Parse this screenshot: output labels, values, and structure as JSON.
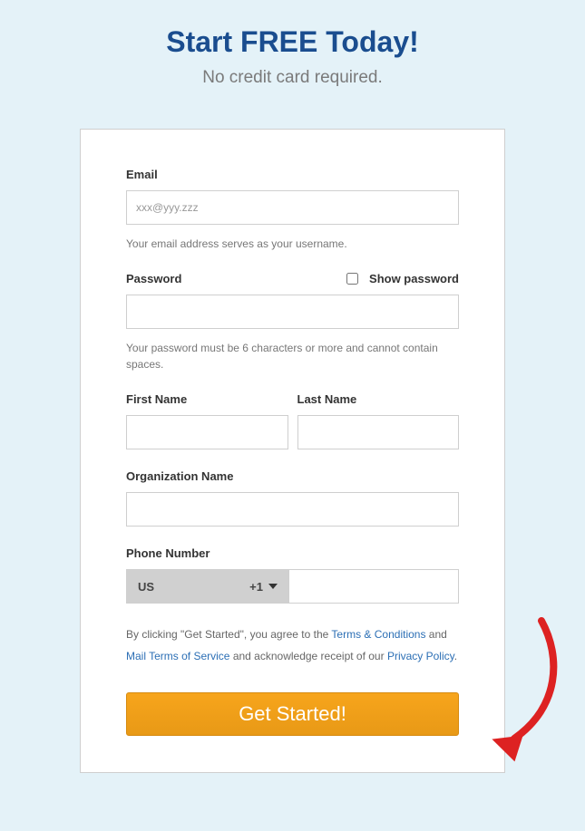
{
  "header": {
    "title": "Start FREE Today!",
    "subtitle": "No credit card required."
  },
  "form": {
    "email": {
      "label": "Email",
      "placeholder": "xxx@yyy.zzz",
      "helper": "Your email address serves as your username."
    },
    "password": {
      "label": "Password",
      "show_label": "Show password",
      "helper": "Your password must be 6 characters or more and cannot contain spaces."
    },
    "first_name": {
      "label": "First Name"
    },
    "last_name": {
      "label": "Last Name"
    },
    "organization": {
      "label": "Organization Name"
    },
    "phone": {
      "label": "Phone Number",
      "country": "US",
      "code": "+1"
    },
    "terms": {
      "prefix": "By clicking \"Get Started\", you agree to the ",
      "link1": "Terms & Conditions",
      "mid1": " and ",
      "link2": "Mail Terms of Service",
      "mid2": " and acknowledge receipt of our ",
      "link3": "Privacy Policy",
      "suffix": "."
    },
    "submit_label": "Get Started!"
  }
}
